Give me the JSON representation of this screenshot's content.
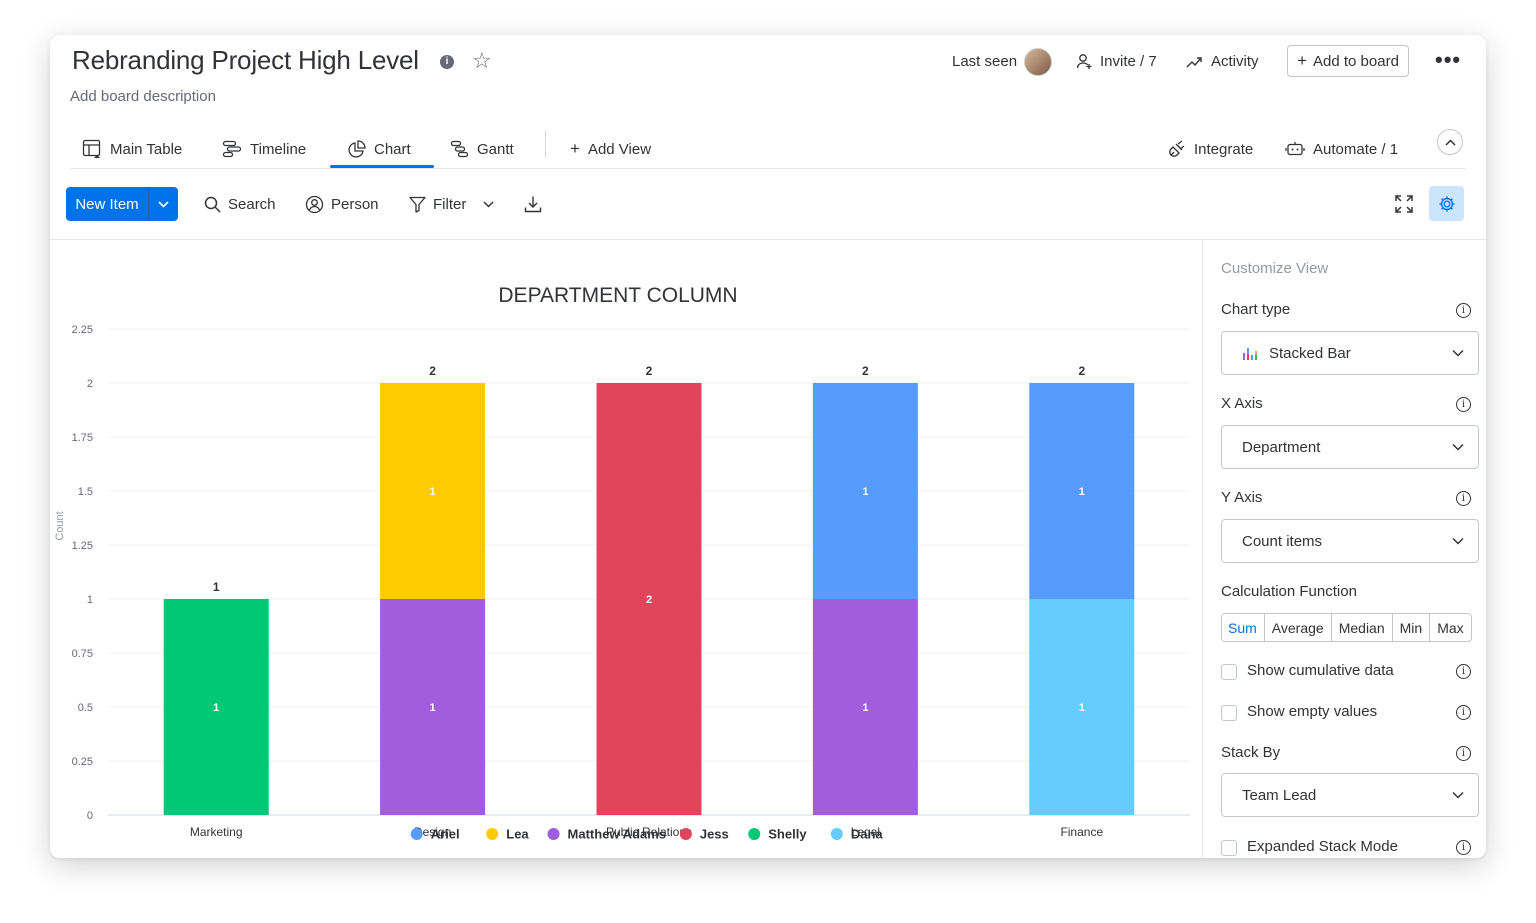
{
  "header": {
    "title": "Rebranding Project High Level",
    "description": "Add board description",
    "last_seen": "Last seen",
    "invite": "Invite / 7",
    "activity": "Activity",
    "add_to_board": "Add to board"
  },
  "views": {
    "tabs": [
      {
        "label": "Main Table"
      },
      {
        "label": "Timeline"
      },
      {
        "label": "Chart"
      },
      {
        "label": "Gantt"
      }
    ],
    "active": "Chart",
    "add_view": "Add View",
    "integrate": "Integrate",
    "automate": "Automate / 1"
  },
  "toolbar": {
    "new_item": "New Item",
    "search": "Search",
    "person": "Person",
    "filter": "Filter"
  },
  "panel": {
    "title": "Customize View",
    "chart_type_label": "Chart type",
    "chart_type_value": "Stacked Bar",
    "x_axis_label": "X Axis",
    "x_axis_value": "Department",
    "y_axis_label": "Y Axis",
    "y_axis_value": "Count items",
    "calc_label": "Calculation Function",
    "calc_options": [
      "Sum",
      "Average",
      "Median",
      "Min",
      "Max"
    ],
    "calc_selected": "Sum",
    "show_cumulative": "Show cumulative data",
    "show_empty": "Show empty values",
    "stack_by_label": "Stack By",
    "stack_by_value": "Team Lead",
    "expanded_stack": "Expanded Stack Mode"
  },
  "chart_data": {
    "type": "bar",
    "stacked": true,
    "title": "DEPARTMENT COLUMN",
    "xlabel": "",
    "ylabel": "Count",
    "ylim": [
      0,
      2.25
    ],
    "yticks": [
      "0",
      "0.25",
      "0.5",
      "0.75",
      "1",
      "1.25",
      "1.5",
      "1.75",
      "2",
      "2.25"
    ],
    "categories": [
      "Marketing",
      "Design",
      "Public Relations",
      "Legal",
      "Finance"
    ],
    "totals": [
      1,
      2,
      2,
      2,
      2
    ],
    "grid": true,
    "legend_position": "bottom",
    "series": [
      {
        "name": "Ariel",
        "color": "#579bfc",
        "values": [
          0,
          0,
          0,
          1,
          1
        ]
      },
      {
        "name": "Lea",
        "color": "#ffcb00",
        "values": [
          0,
          1,
          0,
          0,
          0
        ]
      },
      {
        "name": "Matthew Adams",
        "color": "#a25ddc",
        "values": [
          0,
          1,
          0,
          1,
          0
        ]
      },
      {
        "name": "Jess",
        "color": "#e2445c",
        "values": [
          0,
          0,
          2,
          0,
          0
        ]
      },
      {
        "name": "Shelly",
        "color": "#00c875",
        "values": [
          1,
          0,
          0,
          0,
          0
        ]
      },
      {
        "name": "Dana",
        "color": "#66ccff",
        "values": [
          0,
          0,
          0,
          0,
          1
        ]
      }
    ],
    "stack_order": [
      "Shelly",
      "Matthew Adams",
      "Jess",
      "Dana",
      "Lea",
      "Ariel"
    ]
  }
}
